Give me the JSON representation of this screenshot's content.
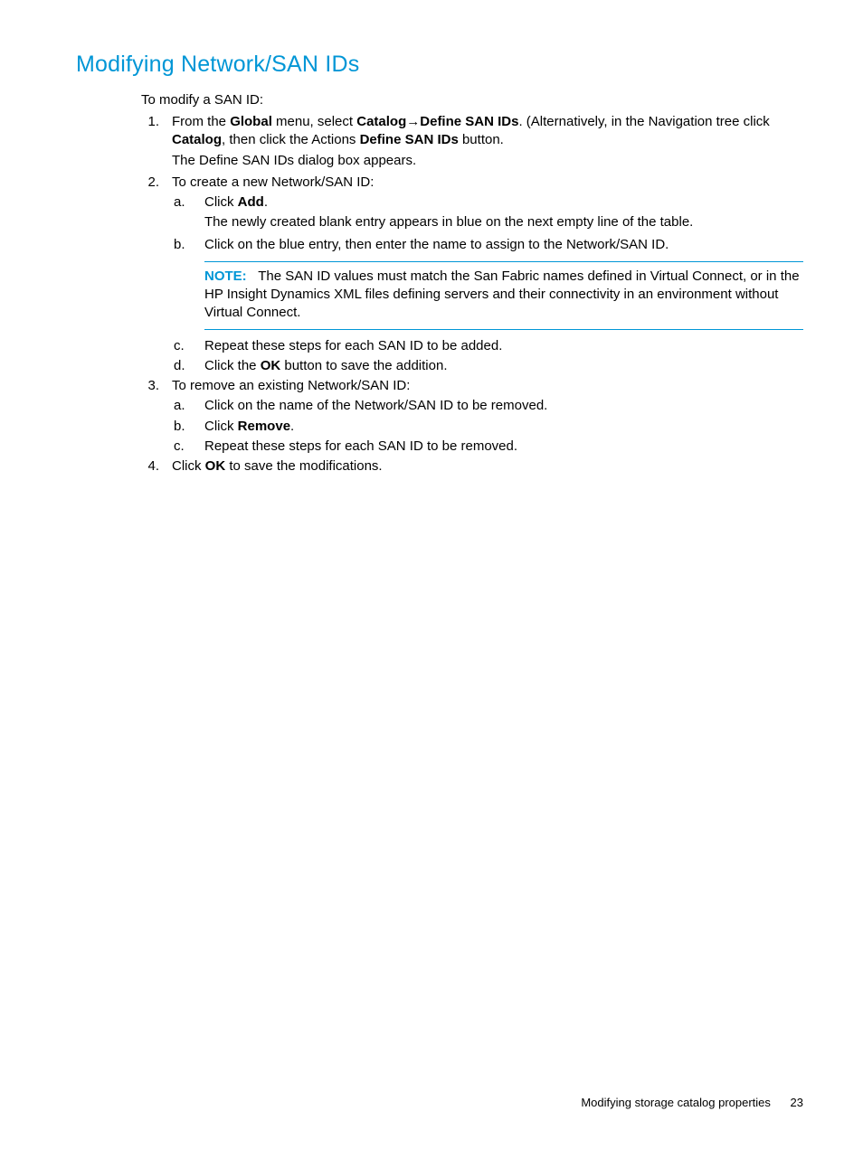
{
  "heading": "Modifying Network/SAN IDs",
  "intro": "To modify a SAN ID:",
  "step1": {
    "marker": "1.",
    "prefix": "From the ",
    "b1": "Global",
    "mid1": " menu, select ",
    "b2": "Catalog",
    "arrow": "→",
    "b3": "Define SAN IDs",
    "mid2": ". (Alternatively, in the Navigation tree click ",
    "b4": "Catalog",
    "mid3": ", then click the Actions ",
    "b5": "Define SAN IDs",
    "suffix": " button.",
    "result": "The Define SAN IDs dialog box appears."
  },
  "step2": {
    "marker": "2.",
    "text": "To create a new Network/SAN ID:",
    "a": {
      "marker": "a.",
      "prefix": "Click ",
      "b1": "Add",
      "suffix": ".",
      "result": "The newly created blank entry appears in blue on the next empty line of the table."
    },
    "b": {
      "marker": "b.",
      "text": "Click on the blue entry, then enter the name to assign to the Network/SAN ID.",
      "note_label": "NOTE:",
      "note_text": "The SAN ID values must match the San Fabric names defined in Virtual Connect, or in the HP Insight Dynamics XML files defining servers and their connectivity in an environment without Virtual Connect."
    },
    "c": {
      "marker": "c.",
      "text": "Repeat these steps for each SAN ID to be added."
    },
    "d": {
      "marker": "d.",
      "prefix": "Click the ",
      "b1": "OK",
      "suffix": " button to save the addition."
    }
  },
  "step3": {
    "marker": "3.",
    "text": "To remove an existing Network/SAN ID:",
    "a": {
      "marker": "a.",
      "text": "Click on the name of the Network/SAN ID to be removed."
    },
    "b": {
      "marker": "b.",
      "prefix": "Click ",
      "b1": "Remove",
      "suffix": "."
    },
    "c": {
      "marker": "c.",
      "text": "Repeat these steps for each SAN ID to be removed."
    }
  },
  "step4": {
    "marker": "4.",
    "prefix": "Click ",
    "b1": "OK",
    "suffix": " to save the modifications."
  },
  "footer": {
    "text": "Modifying storage catalog properties",
    "page": "23"
  }
}
